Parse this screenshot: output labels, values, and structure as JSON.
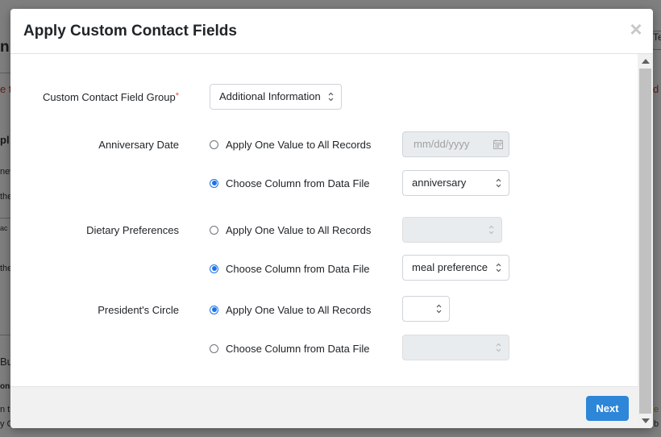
{
  "background": {
    "fragments": [
      "n",
      "e t",
      "d",
      "pl",
      "nev",
      "the",
      "ac",
      "the",
      "Bu",
      "ons",
      "n t",
      "y C",
      "b",
      "e",
      "Tem"
    ]
  },
  "modal": {
    "title": "Apply Custom Contact Fields",
    "close_glyph": "×",
    "next_label": "Next"
  },
  "form": {
    "group_label": "Custom Contact Field Group",
    "required_mark": "*",
    "group_value": "Additional Information",
    "option_one_value": "Apply One Value to All Records",
    "option_column": "Choose Column from Data File",
    "fields": [
      {
        "label": "Anniversary Date",
        "selected": "column",
        "value_placeholder": "mm/dd/yyyy",
        "column_value": "anniversary"
      },
      {
        "label": "Dietary Preferences",
        "selected": "column",
        "value": "",
        "column_value": "meal preference"
      },
      {
        "label": "President's Circle",
        "selected": "one_value",
        "value": "",
        "column_value": ""
      }
    ]
  },
  "colors": {
    "primary": "#2d86d8",
    "radio_checked": "#1a73e8",
    "required": "#d9534f"
  }
}
